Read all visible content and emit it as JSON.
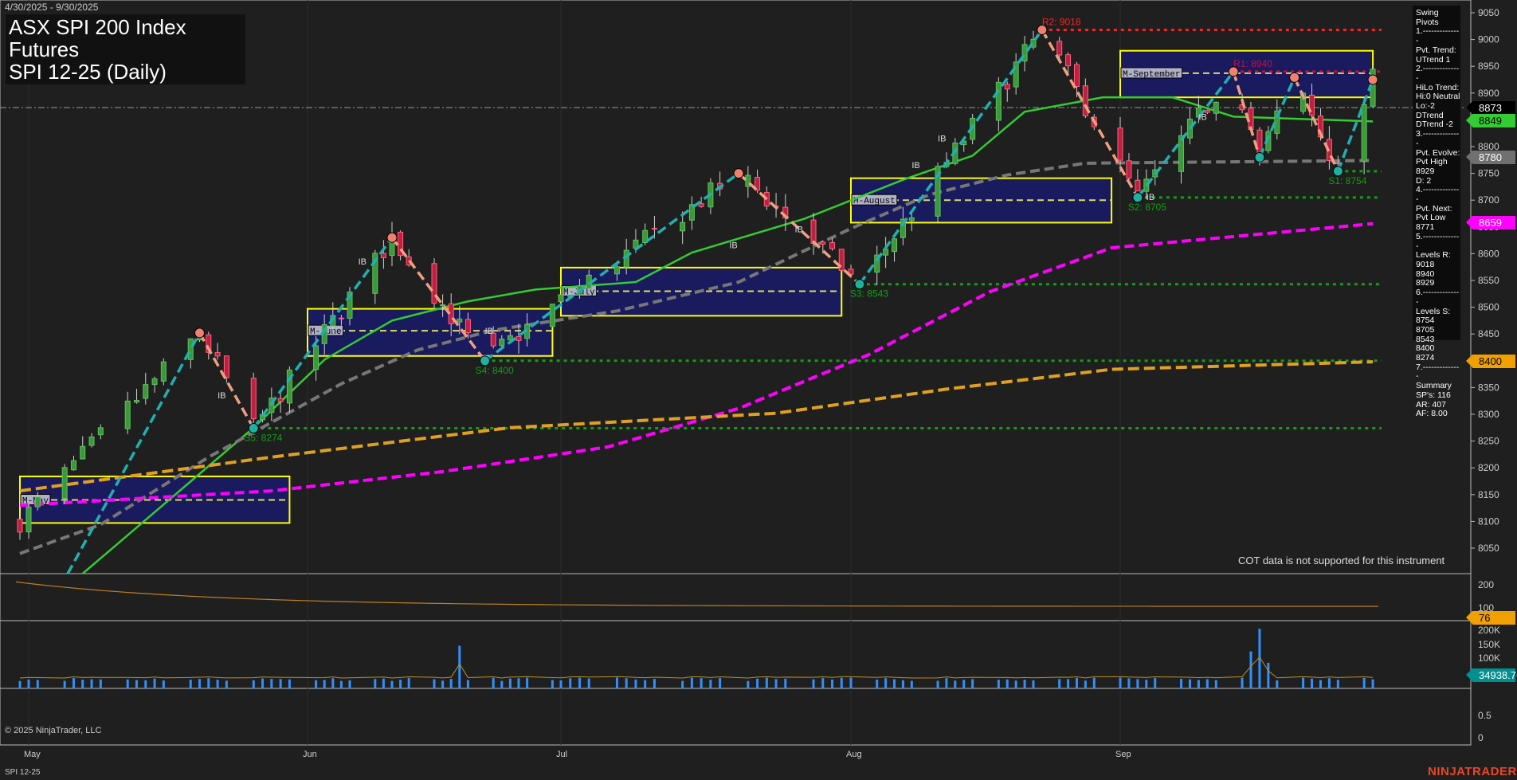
{
  "header": {
    "date_range": "4/30/2025 - 9/30/2025",
    "title": "ASX SPI 200 Index Futures",
    "subtitle": "SPI 12-25 (Daily)"
  },
  "swing_panel": {
    "lines": [
      "Swing Pivots",
      "1.--------------",
      "Pvt. Trend:",
      "UTrend 1",
      "2.--------------",
      "HiLo Trend:",
      "Hi:0 Neutral",
      "Lo:-2 DTrend",
      "DTrend -2",
      "3.--------------",
      "Pvt. Evolve:",
      "Pvt High",
      "8929",
      "D: 2",
      "4.--------------",
      "Pvt. Next:",
      "Pvt Low",
      "8771",
      "5.--------------",
      "Levels R:",
      "9018",
      "8940",
      "8929",
      "6.--------------",
      "Levels S:",
      "8754",
      "8705",
      "8543",
      "8400",
      "8274",
      "7.--------------",
      "Summary",
      "SP's: 116",
      "AR: 407",
      "AF: 8.00"
    ]
  },
  "cot_note": "COT data is not supported for this instrument",
  "copyright": "© 2025 NinjaTrader, LLC",
  "symbol_footer": "SPI 12-25",
  "brand": "NINJATRADER",
  "price_flags": [
    {
      "value": "8873",
      "bg": "#000000",
      "fg": "#ffffff",
      "price": 8873
    },
    {
      "value": "8849",
      "bg": "#33cc33",
      "fg": "#000000",
      "price": 8849
    },
    {
      "value": "8780",
      "bg": "#707070",
      "fg": "#ffffff",
      "price": 8780
    },
    {
      "value": "8659",
      "bg": "#ff00ff",
      "fg": "#ffffff",
      "price": 8659
    },
    {
      "value": "8400",
      "bg": "#f0a000",
      "fg": "#000000",
      "price": 8400
    }
  ],
  "lower_flags": [
    {
      "value": "76",
      "bg": "#f0a000",
      "fg": "#000000"
    },
    {
      "value": "34938.76",
      "bg": "#009090",
      "fg": "#ffffff"
    }
  ],
  "chart_data": {
    "type": "candlestick",
    "title": "ASX SPI 200 Index Futures SPI 12-25 (Daily)",
    "x_ticks": [
      "May",
      "Jun",
      "Jul",
      "Aug",
      "Sep"
    ],
    "y_ticks": [
      8050,
      8100,
      8150,
      8200,
      8250,
      8300,
      8350,
      8400,
      8450,
      8500,
      8550,
      8600,
      8650,
      8700,
      8750,
      8800,
      8850,
      8900,
      8950,
      9000,
      9050
    ],
    "ylim": [
      8020,
      9075
    ],
    "swing_pivots": [
      {
        "date": "04-30",
        "price": 8100
      },
      {
        "date": "05-20",
        "price": 8452,
        "type": "high"
      },
      {
        "date": "05-26",
        "price": 8274,
        "type": "low"
      },
      {
        "date": "06-11",
        "price": 8630,
        "type": "high"
      },
      {
        "date": "06-22",
        "price": 8400,
        "type": "low"
      },
      {
        "date": "07-20",
        "price": 8750,
        "type": "high"
      },
      {
        "date": "08-02",
        "price": 8543,
        "type": "low"
      },
      {
        "date": "08-23",
        "price": 9018,
        "type": "high"
      },
      {
        "date": "09-03",
        "price": 8705,
        "type": "low"
      },
      {
        "date": "09-14",
        "price": 8940,
        "type": "high"
      },
      {
        "date": "09-17",
        "price": 8780,
        "type": "low"
      },
      {
        "date": "09-21",
        "price": 8929,
        "type": "high"
      },
      {
        "date": "09-26",
        "price": 8754,
        "type": "low"
      },
      {
        "date": "09-30",
        "price": 8925,
        "type": "high"
      }
    ],
    "levels": [
      {
        "label": "R2: 9018",
        "price": 9018,
        "from": "08-23",
        "color": "#ff2020"
      },
      {
        "label": "R1: 8940",
        "price": 8940,
        "from": "09-14",
        "color": "#c0104a"
      },
      {
        "label": "S1: 8754",
        "price": 8754,
        "from": "09-26",
        "color": "#10a010"
      },
      {
        "label": "S2: 8705",
        "price": 8705,
        "from": "09-03",
        "color": "#10a010"
      },
      {
        "label": "S3: 8543",
        "price": 8543,
        "from": "08-02",
        "color": "#10a010"
      },
      {
        "label": "S4: 8400",
        "price": 8400,
        "from": "06-22",
        "color": "#10a010"
      },
      {
        "label": "S5: 8274",
        "price": 8274,
        "from": "05-26",
        "color": "#10a010"
      }
    ],
    "monthly_boxes": [
      {
        "label": "M-May",
        "from": "04-30",
        "to": "05-30",
        "high": 8184,
        "low": 8097,
        "mid": 8140
      },
      {
        "label": "M-June",
        "from": "06-01",
        "to": "06-30",
        "high": 8497,
        "low": 8409,
        "mid": 8456
      },
      {
        "label": "M-July",
        "from": "07-01",
        "to": "07-31",
        "high": 8574,
        "low": 8484,
        "mid": 8530
      },
      {
        "label": "M-August",
        "from": "08-01",
        "to": "08-31",
        "high": 8741,
        "low": 8658,
        "mid": 8700
      },
      {
        "label": "M-September",
        "from": "09-01",
        "to": "09-30",
        "high": 8979,
        "low": 8892,
        "mid": 8937
      }
    ],
    "moving_averages": [
      {
        "name": "fast",
        "color": "#33cc33",
        "dash": "",
        "points": [
          [
            "05-07",
            8000
          ],
          [
            "05-26",
            8275
          ],
          [
            "06-03",
            8402
          ],
          [
            "06-11",
            8475
          ],
          [
            "06-20",
            8511
          ],
          [
            "06-28",
            8533
          ],
          [
            "07-09",
            8547
          ],
          [
            "07-15",
            8602
          ],
          [
            "07-27",
            8665
          ],
          [
            "08-07",
            8738
          ],
          [
            "08-15",
            8783
          ],
          [
            "08-21",
            8865
          ],
          [
            "08-30",
            8892
          ],
          [
            "09-07",
            8892
          ],
          [
            "09-14",
            8856
          ],
          [
            "09-30",
            8847
          ]
        ]
      },
      {
        "name": "ma50",
        "color": "#777777",
        "dash": "12,6",
        "points": [
          [
            "04-30",
            8040
          ],
          [
            "05-09",
            8094
          ],
          [
            "05-21",
            8220
          ],
          [
            "06-05",
            8357
          ],
          [
            "06-14",
            8420
          ],
          [
            "06-23",
            8457
          ],
          [
            "07-07",
            8493
          ],
          [
            "07-20",
            8547
          ],
          [
            "08-01",
            8647
          ],
          [
            "08-10",
            8710
          ],
          [
            "08-19",
            8747
          ],
          [
            "08-28",
            8769
          ],
          [
            "09-30",
            8774
          ]
        ]
      },
      {
        "name": "ma100",
        "color": "#ff00ff",
        "dash": "12,6",
        "points": [
          [
            "04-30",
            8130
          ],
          [
            "05-28",
            8157
          ],
          [
            "06-17",
            8193
          ],
          [
            "07-06",
            8239
          ],
          [
            "07-20",
            8311
          ],
          [
            "08-03",
            8411
          ],
          [
            "08-17",
            8529
          ],
          [
            "08-31",
            8611
          ],
          [
            "09-30",
            8656
          ]
        ]
      },
      {
        "name": "ma200",
        "color": "#e0a020",
        "dash": "14,6",
        "points": [
          [
            "04-30",
            8157
          ],
          [
            "05-28",
            8220
          ],
          [
            "06-25",
            8275
          ],
          [
            "07-24",
            8302
          ],
          [
            "08-12",
            8347
          ],
          [
            "08-31",
            8384
          ],
          [
            "09-30",
            8398
          ]
        ]
      }
    ],
    "ib_labels": [
      [
        "05-22",
        8330
      ],
      [
        "06-07",
        8580
      ],
      [
        "06-22",
        8450
      ],
      [
        "07-19",
        8610
      ],
      [
        "07-26",
        8640
      ],
      [
        "08-11",
        8810
      ],
      [
        "08-08",
        8760
      ],
      [
        "09-04",
        8700
      ],
      [
        "09-10",
        8850
      ]
    ],
    "indicator": {
      "ticks": [
        "200",
        "100"
      ],
      "last": 76
    },
    "volume": {
      "ticks": [
        "200K",
        "150K",
        "100K"
      ],
      "last": 34938.76
    },
    "lower_ticks": [
      "0.5",
      "0"
    ]
  }
}
